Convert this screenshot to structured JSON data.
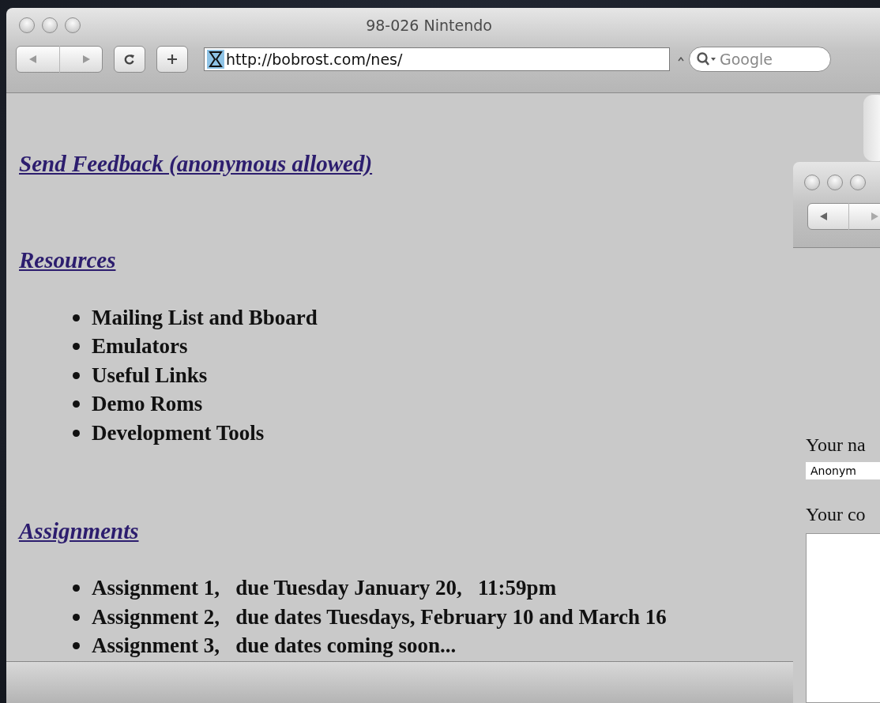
{
  "window": {
    "title": "98-026 Nintendo"
  },
  "toolbar": {
    "address": "http://bobrost.com/nes/",
    "search_placeholder": "Google"
  },
  "sections": [
    {
      "heading": "Send Feedback (anonymous allowed)"
    },
    {
      "heading": "Resources",
      "items": [
        "Mailing List and Bboard",
        "Emulators",
        "Useful Links",
        "Demo Roms",
        "Development Tools"
      ]
    },
    {
      "heading": "Assignments",
      "items": [
        "Assignment 1,   due Tuesday January 20,   11:59pm",
        "Assignment 2,   due dates Tuesdays, February 10 and March 16",
        "Assignment 3,   due dates coming soon..."
      ]
    }
  ],
  "second_window": {
    "name_label": "Your na",
    "name_value": "Anonym",
    "comment_label": "Your co"
  }
}
